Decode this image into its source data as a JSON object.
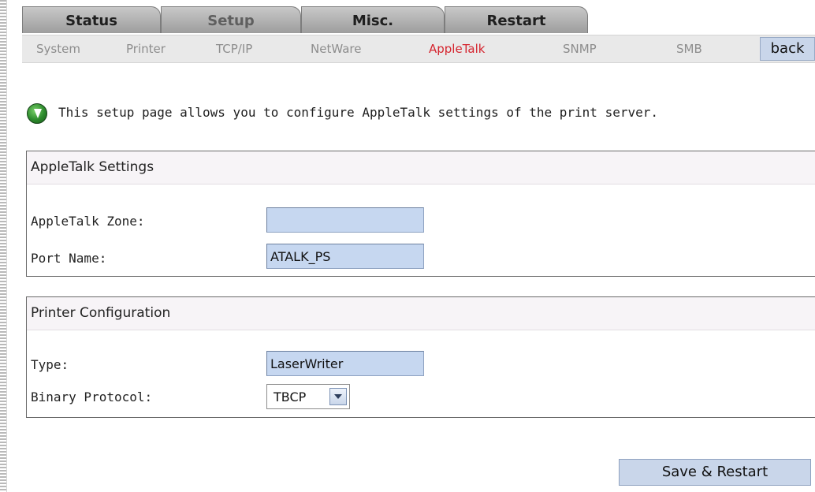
{
  "tabs": [
    "Status",
    "Setup",
    "Misc.",
    "Restart"
  ],
  "subnav": {
    "items": [
      "System",
      "Printer",
      "TCP/IP",
      "NetWare",
      "AppleTalk",
      "SNMP",
      "SMB"
    ],
    "active": "AppleTalk",
    "back_label": "back"
  },
  "intro": {
    "text": "This setup page allows you to configure AppleTalk settings of the print server."
  },
  "appletalk_settings": {
    "title": "AppleTalk Settings",
    "zone_label": "AppleTalk Zone:",
    "zone_value": "",
    "port_label": "Port Name:",
    "port_value": "ATALK_PS"
  },
  "printer_configuration": {
    "title": "Printer Configuration",
    "type_label": "Type:",
    "type_value": "LaserWriter",
    "protocol_label": "Binary Protocol:",
    "protocol_value": "TBCP"
  },
  "save_label": "Save & Restart",
  "colors": {
    "active_subnav": "#d5252f",
    "field_background": "#c6d7f0",
    "button_background": "#c9d6ea"
  }
}
